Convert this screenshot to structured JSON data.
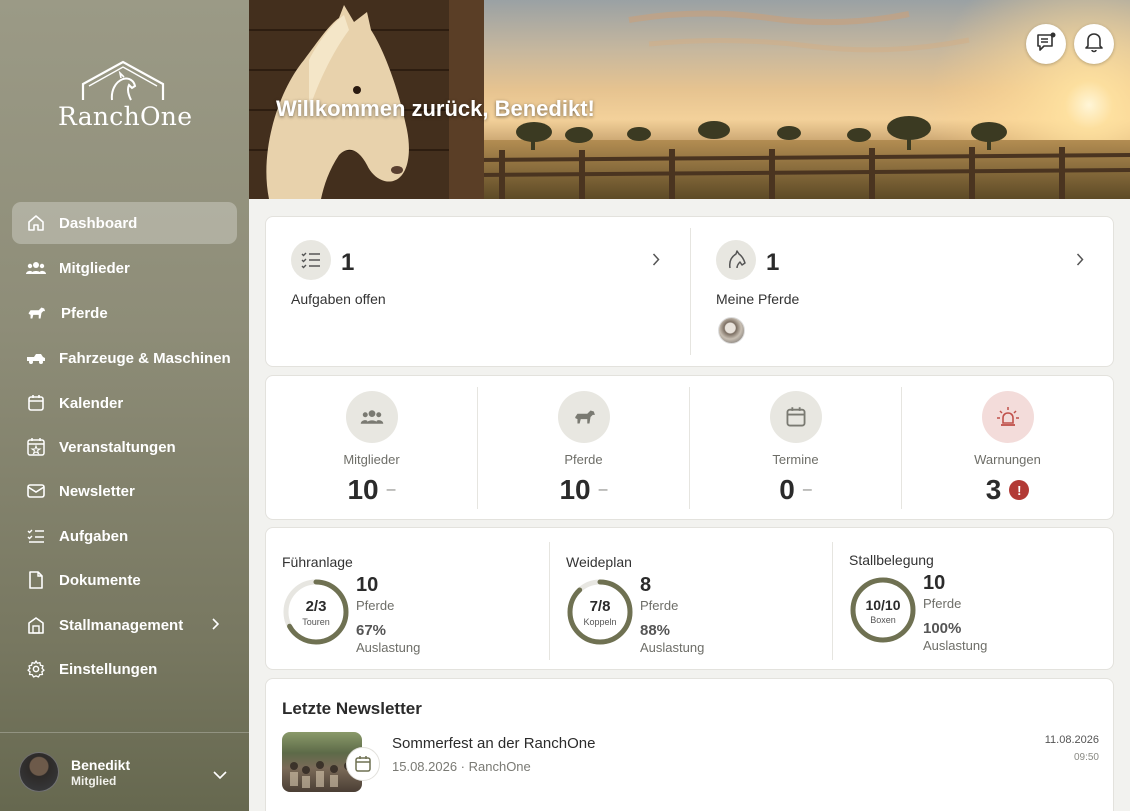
{
  "app": {
    "name": "RanchOne"
  },
  "sidebar": {
    "items": [
      {
        "label": "Dashboard",
        "icon": "home-icon",
        "active": true
      },
      {
        "label": "Mitglieder",
        "icon": "users-icon"
      },
      {
        "label": "Pferde",
        "icon": "horse-icon"
      },
      {
        "label": "Fahrzeuge & Maschinen",
        "icon": "truck-icon"
      },
      {
        "label": "Kalender",
        "icon": "calendar-icon"
      },
      {
        "label": "Veranstaltungen",
        "icon": "event-calendar-icon"
      },
      {
        "label": "Newsletter",
        "icon": "mail-icon"
      },
      {
        "label": "Aufgaben",
        "icon": "checklist-icon"
      },
      {
        "label": "Dokumente",
        "icon": "document-icon"
      },
      {
        "label": "Stallmanagement",
        "icon": "barn-icon"
      },
      {
        "label": "Einstellungen",
        "icon": "gear-icon"
      }
    ],
    "user": {
      "name": "Benedikt",
      "role": "Mitglied"
    }
  },
  "hero": {
    "title": "Willkommen zurück, Benedikt!"
  },
  "summary": {
    "tasks": {
      "count": "1",
      "label": "Aufgaben offen"
    },
    "horses": {
      "count": "1",
      "label": "Meine Pferde"
    }
  },
  "stats": [
    {
      "label": "Mitglieder",
      "value": "10",
      "suffix": "–",
      "icon": "users-icon"
    },
    {
      "label": "Pferde",
      "value": "10",
      "suffix": "–",
      "icon": "horse-icon"
    },
    {
      "label": "Termine",
      "value": "0",
      "suffix": "–",
      "icon": "calendar-icon"
    },
    {
      "label": "Warnungen",
      "value": "3",
      "suffix": "!",
      "icon": "siren-icon",
      "alert_color": "#b23a36"
    }
  ],
  "capacity": [
    {
      "title": "Führanlage",
      "ring_text": "2/3",
      "ring_sub": "Touren",
      "fraction": 0.67,
      "count": "10",
      "unit": "Pferde",
      "percent": "67%",
      "percent_label": "Auslastung"
    },
    {
      "title": "Weideplan",
      "ring_text": "7/8",
      "ring_sub": "Koppeln",
      "fraction": 0.88,
      "count": "8",
      "unit": "Pferde",
      "percent": "88%",
      "percent_label": "Auslastung"
    },
    {
      "title": "Stallbelegung",
      "ring_text": "10/10",
      "ring_sub": "Boxen",
      "fraction": 1.0,
      "count": "10",
      "unit": "Pferde",
      "percent": "100%",
      "percent_label": "Auslastung"
    }
  ],
  "newsletter": {
    "heading": "Letzte Newsletter",
    "items": [
      {
        "title": "Sommerfest an der RanchOne",
        "meta": "15.08.2026 · RanchOne",
        "date": "11.08.2026",
        "time": "09:50"
      }
    ]
  },
  "colors": {
    "accent": "#6f7152",
    "ring_track": "#e7e6e1",
    "alert": "#b23a36"
  }
}
